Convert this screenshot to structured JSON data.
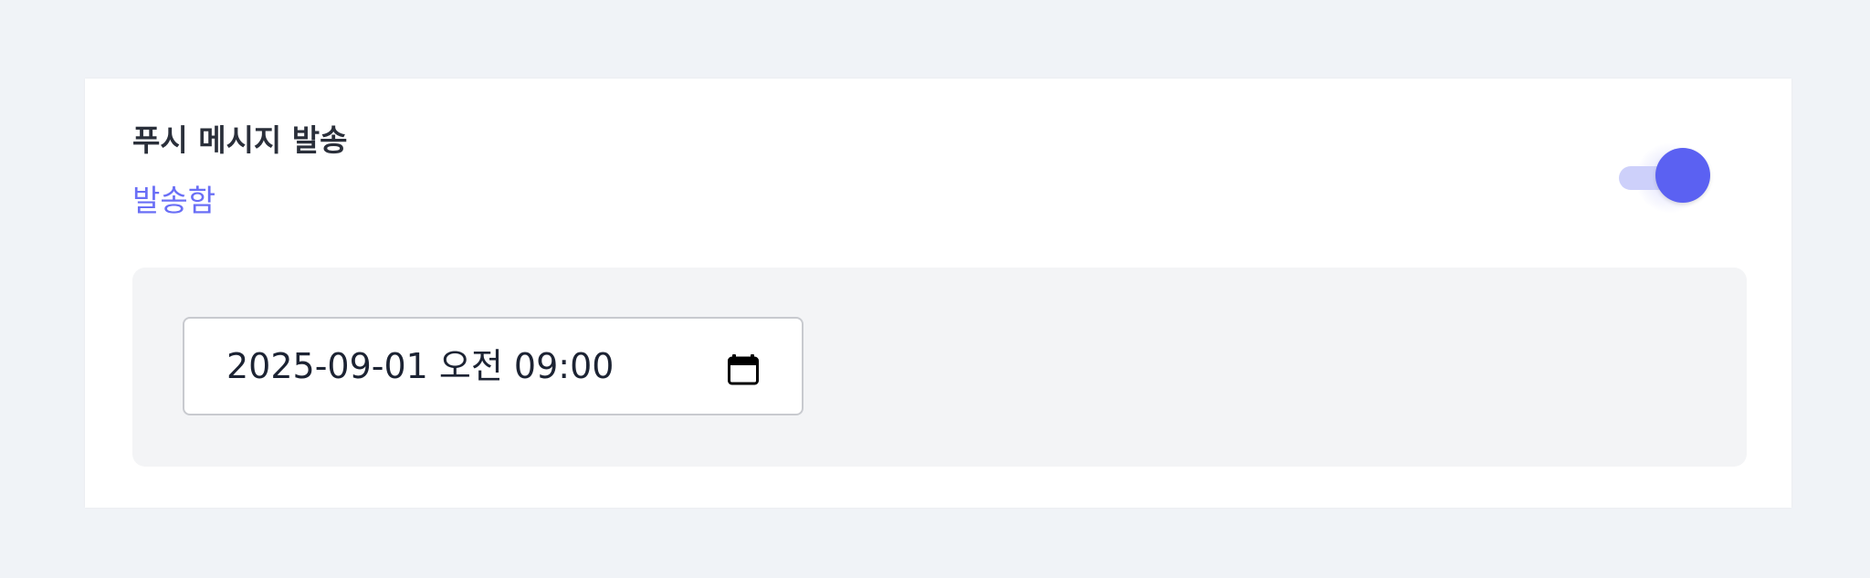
{
  "push_section": {
    "title": "푸시 메시지 발송",
    "status_label": "발송함",
    "toggle_on": true
  },
  "schedule": {
    "datetime_value": "2025-09-01 오전 09:00",
    "icon": "calendar-icon"
  },
  "colors": {
    "accent": "#5b61f2",
    "accent_light": "#cdd0fa",
    "status_text": "#6a6ff6",
    "page_background": "#f0f3f7",
    "panel_background": "#f3f4f6"
  }
}
